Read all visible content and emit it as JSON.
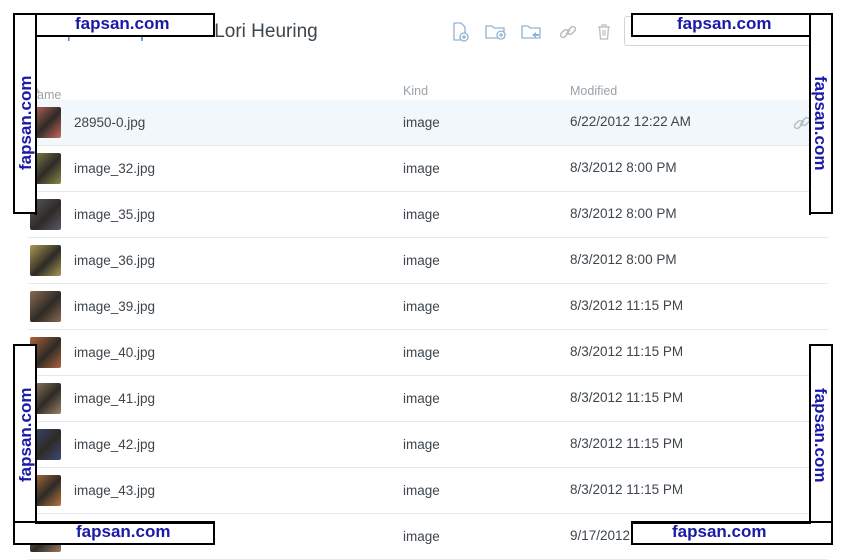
{
  "breadcrumb": {
    "items": [
      {
        "label": "Dropbox"
      },
      {
        "label": "Uploads"
      }
    ],
    "current": "Lori Heuring"
  },
  "toolbar": [
    {
      "icon": "new-file-icon"
    },
    {
      "icon": "new-folder-icon"
    },
    {
      "icon": "shared-folder-icon"
    },
    {
      "icon": "link-icon"
    },
    {
      "icon": "trash-icon"
    }
  ],
  "search": {
    "placeholder": "",
    "value": ""
  },
  "columns": {
    "name": "Name",
    "kind": "Kind",
    "modified": "Modified"
  },
  "files": [
    {
      "name": "28950-0.jpg",
      "kind": "image",
      "modified": "6/22/2012 12:22 AM",
      "selected": true,
      "thumb": "#c86a5e"
    },
    {
      "name": "image_32.jpg",
      "kind": "image",
      "modified": "8/3/2012 8:00 PM",
      "thumb": "#8a8a48"
    },
    {
      "name": "image_35.jpg",
      "kind": "image",
      "modified": "8/3/2012 8:00 PM",
      "thumb": "#5a5a66"
    },
    {
      "name": "image_36.jpg",
      "kind": "image",
      "modified": "8/3/2012 8:00 PM",
      "thumb": "#a99a55"
    },
    {
      "name": "image_39.jpg",
      "kind": "image",
      "modified": "8/3/2012 11:15 PM",
      "thumb": "#8a6a52"
    },
    {
      "name": "image_40.jpg",
      "kind": "image",
      "modified": "8/3/2012 11:15 PM",
      "thumb": "#b0643a"
    },
    {
      "name": "image_41.jpg",
      "kind": "image",
      "modified": "8/3/2012 11:15 PM",
      "thumb": "#9c8066"
    },
    {
      "name": "image_42.jpg",
      "kind": "image",
      "modified": "8/3/2012 11:15 PM",
      "thumb": "#3a4a7a"
    },
    {
      "name": "image_43.jpg",
      "kind": "image",
      "modified": "8/3/2012 11:15 PM",
      "thumb": "#b9773f"
    },
    {
      "name": "",
      "kind": "image",
      "modified": "9/17/2012",
      "thumb": "#9a7a5e"
    }
  ],
  "watermarks": {
    "top_left": "fapsan.com",
    "top_right": "fapsan.com",
    "bottom_left": "fapsan.com",
    "bottom_right": "fapsan.com",
    "left_upper": "fapsan.com",
    "left_lower": "fapsan.com",
    "right_upper": "fapsan.com",
    "right_lower": "fapsan.com"
  },
  "colors": {
    "accent": "#5a8fc7",
    "watermark_text": "#1a1aa6",
    "selected_row": "#f2f7fc"
  }
}
